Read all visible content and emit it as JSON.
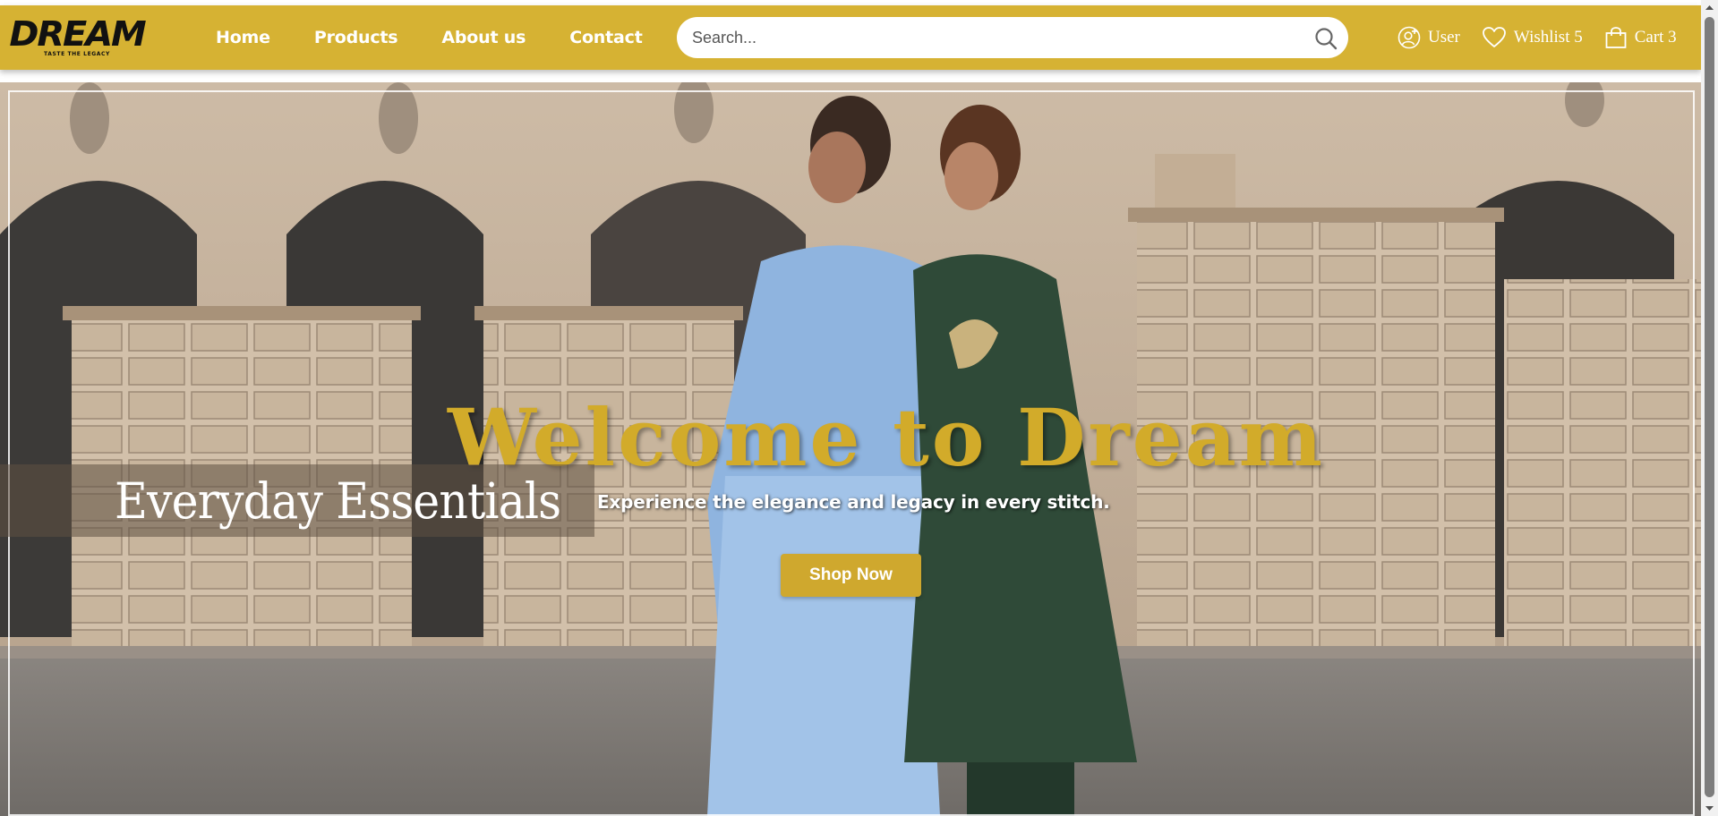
{
  "brand": {
    "logo_text": "DREAM",
    "logo_tagline": "TASTE THE LEGACY",
    "accent_color": "#d6b233"
  },
  "nav": {
    "items": [
      {
        "label": "Home"
      },
      {
        "label": "Products"
      },
      {
        "label": "About us"
      },
      {
        "label": "Contact"
      }
    ]
  },
  "search": {
    "placeholder": "Search..."
  },
  "header_actions": {
    "user_label": "User",
    "wishlist_label": "Wishlist 5",
    "cart_label": "Cart 3"
  },
  "hero": {
    "headline": "Welcome to Dream",
    "tagline": "Everyday Essentials",
    "subtext": "Experience the elegance and legacy in every stitch.",
    "cta_label": "Shop Now",
    "headline_color": "#d2ab2a"
  },
  "icons": [
    "search-icon",
    "user-add-icon",
    "heart-icon",
    "shopping-bag-icon",
    "arrow-up-icon",
    "arrow-down-icon"
  ]
}
